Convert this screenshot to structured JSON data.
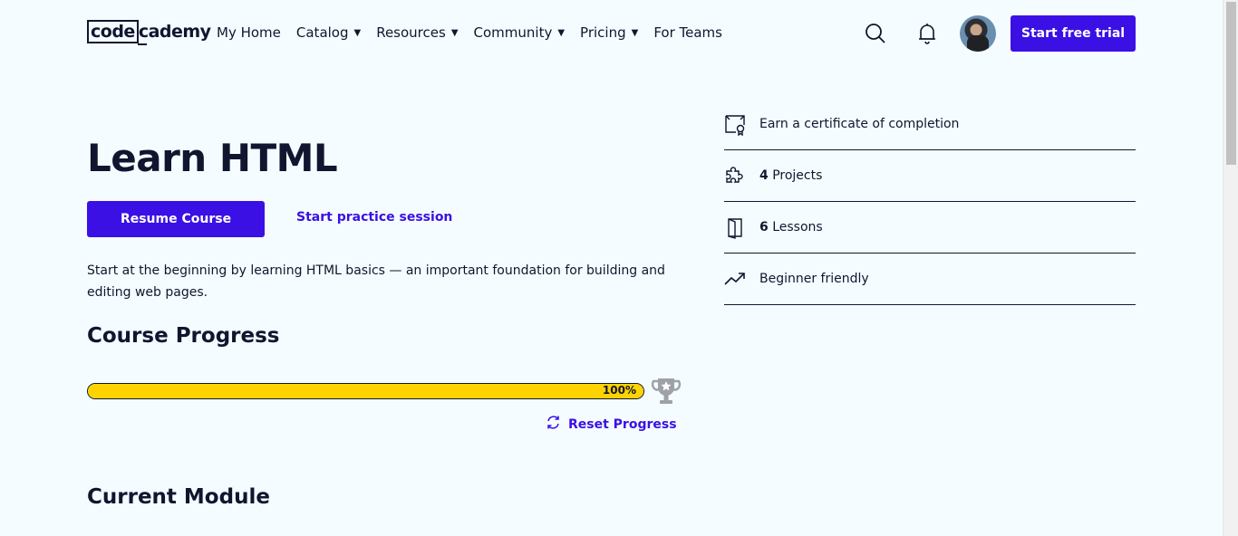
{
  "header": {
    "logo_part1": "code",
    "logo_part2": "cademy",
    "nav": [
      {
        "label": "My Home",
        "has_caret": false
      },
      {
        "label": "Catalog",
        "has_caret": true
      },
      {
        "label": "Resources",
        "has_caret": true
      },
      {
        "label": "Community",
        "has_caret": true
      },
      {
        "label": "Pricing",
        "has_caret": true
      },
      {
        "label": "For Teams",
        "has_caret": false
      }
    ],
    "caret_glyph": "▼",
    "trial_button": "Start free trial"
  },
  "course": {
    "title": "Learn HTML",
    "resume_button": "Resume Course",
    "practice_link": "Start practice session",
    "description": "Start at the beginning by learning HTML basics — an important foundation for building and editing web pages.",
    "progress_heading": "Course Progress",
    "progress_value": 1.0,
    "progress_label": "100%",
    "reset_label": "Reset Progress",
    "module_heading": "Current Module"
  },
  "facts": [
    {
      "icon": "certificate-icon",
      "count": "",
      "text": "Earn a certificate of completion"
    },
    {
      "icon": "puzzle-icon",
      "count": "4",
      "text": " Projects"
    },
    {
      "icon": "book-icon",
      "count": "6",
      "text": " Lessons"
    },
    {
      "icon": "trend-up-icon",
      "count": "",
      "text": "Beginner friendly"
    }
  ],
  "colors": {
    "accent": "#3a10e5",
    "progress_fill": "#ffd300",
    "background": "#f5fcff",
    "text": "#10162f"
  }
}
